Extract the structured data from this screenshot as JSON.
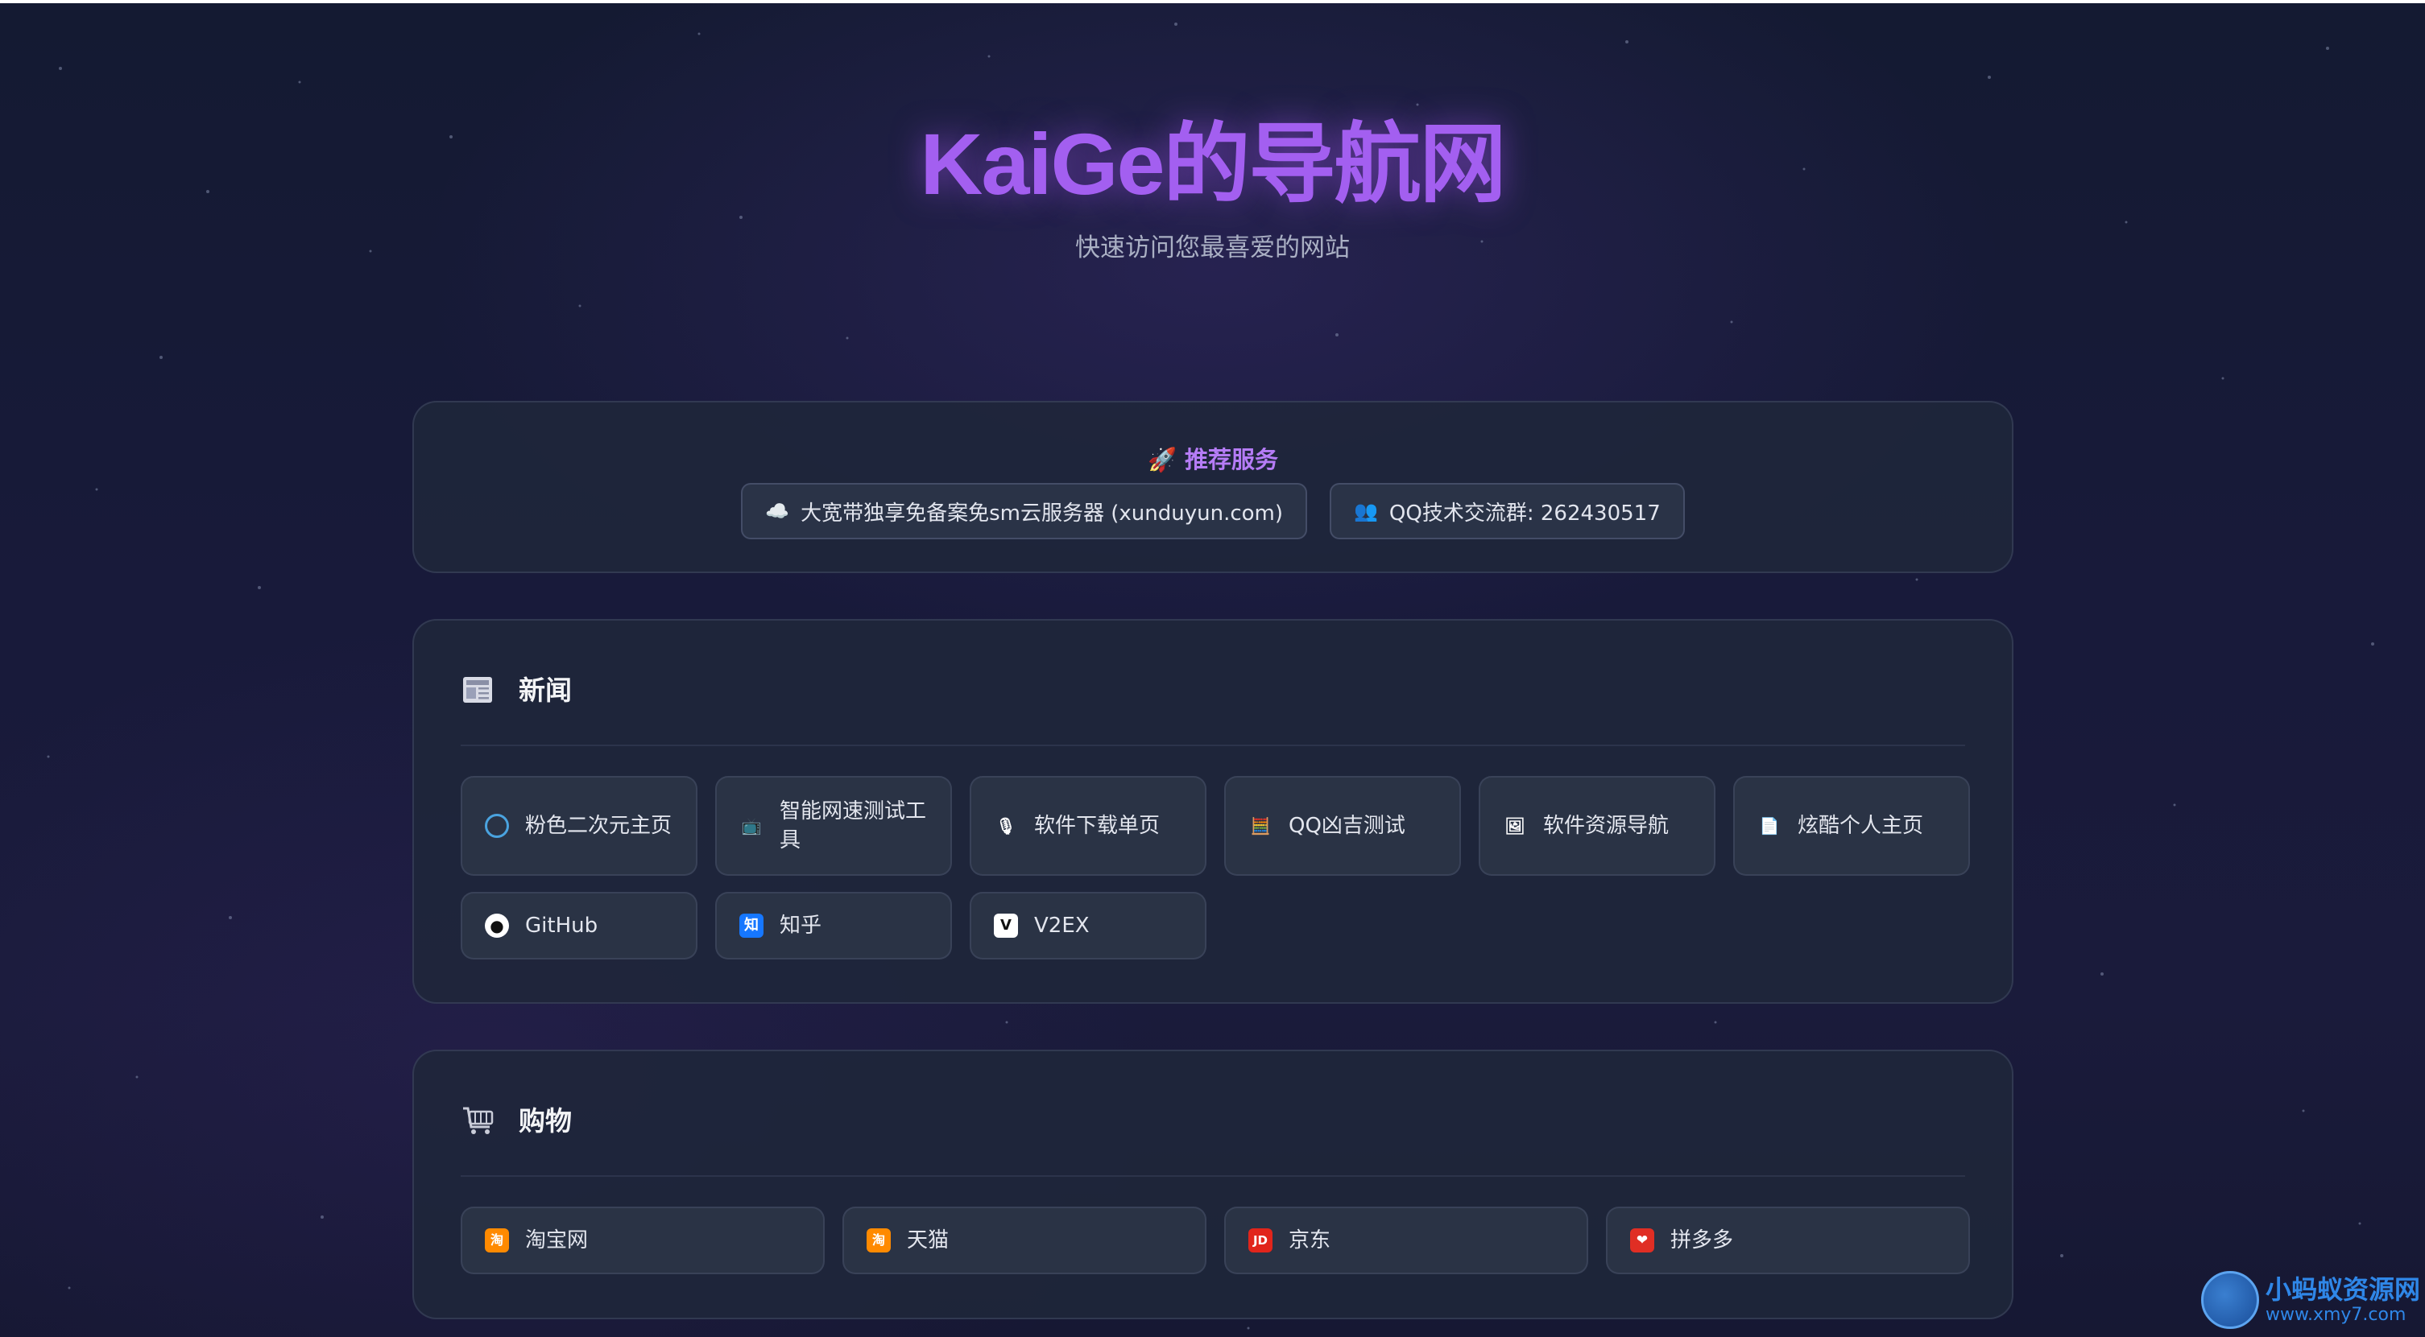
{
  "header": {
    "title": "KaiGe的导航网",
    "subtitle": "快速访问您最喜爱的网站"
  },
  "recommended": {
    "title": "推荐服务",
    "icon": "rocket-icon",
    "items": [
      {
        "label": "大宽带独享免备案免sm云服务器 (xunduyun.com)",
        "icon": "cloud-icon"
      },
      {
        "label": "QQ技术交流群: 262430517",
        "icon": "group-icon"
      }
    ]
  },
  "sections": {
    "news": {
      "title": "新闻",
      "icon": "newspaper-icon",
      "links": [
        {
          "label": "粉色二次元主页",
          "icon": "globe-icon"
        },
        {
          "label": "智能网速测试工具",
          "icon": "tv-icon"
        },
        {
          "label": "软件下载单页",
          "icon": "microphone-icon"
        },
        {
          "label": "QQ凶吉测试",
          "icon": "abacus-icon"
        },
        {
          "label": "软件资源导航",
          "icon": "window-icon"
        },
        {
          "label": "炫酷个人主页",
          "icon": "document-icon"
        },
        {
          "label": "GitHub",
          "icon": "github-icon"
        },
        {
          "label": "知乎",
          "icon": "zhihu-icon",
          "badge": "知"
        },
        {
          "label": "V2EX",
          "icon": "v2ex-icon",
          "badge": "V"
        }
      ]
    },
    "shopping": {
      "title": "购物",
      "icon": "shopping-cart-icon",
      "links": [
        {
          "label": "淘宝网",
          "icon": "taobao-icon",
          "badge": "淘"
        },
        {
          "label": "天猫",
          "icon": "tmall-icon",
          "badge": "淘"
        },
        {
          "label": "京东",
          "icon": "jd-icon",
          "badge": "JD"
        },
        {
          "label": "拼多多",
          "icon": "pinduoduo-icon",
          "badge": "❤"
        }
      ]
    }
  },
  "watermark": {
    "name": "小蚂蚁资源网",
    "url": "www.xmy7.com"
  },
  "colors": {
    "title": "#a35ff0",
    "accent": "#b57cf6",
    "card_bg": "#1f273a",
    "link_bg": "#2a3345"
  }
}
